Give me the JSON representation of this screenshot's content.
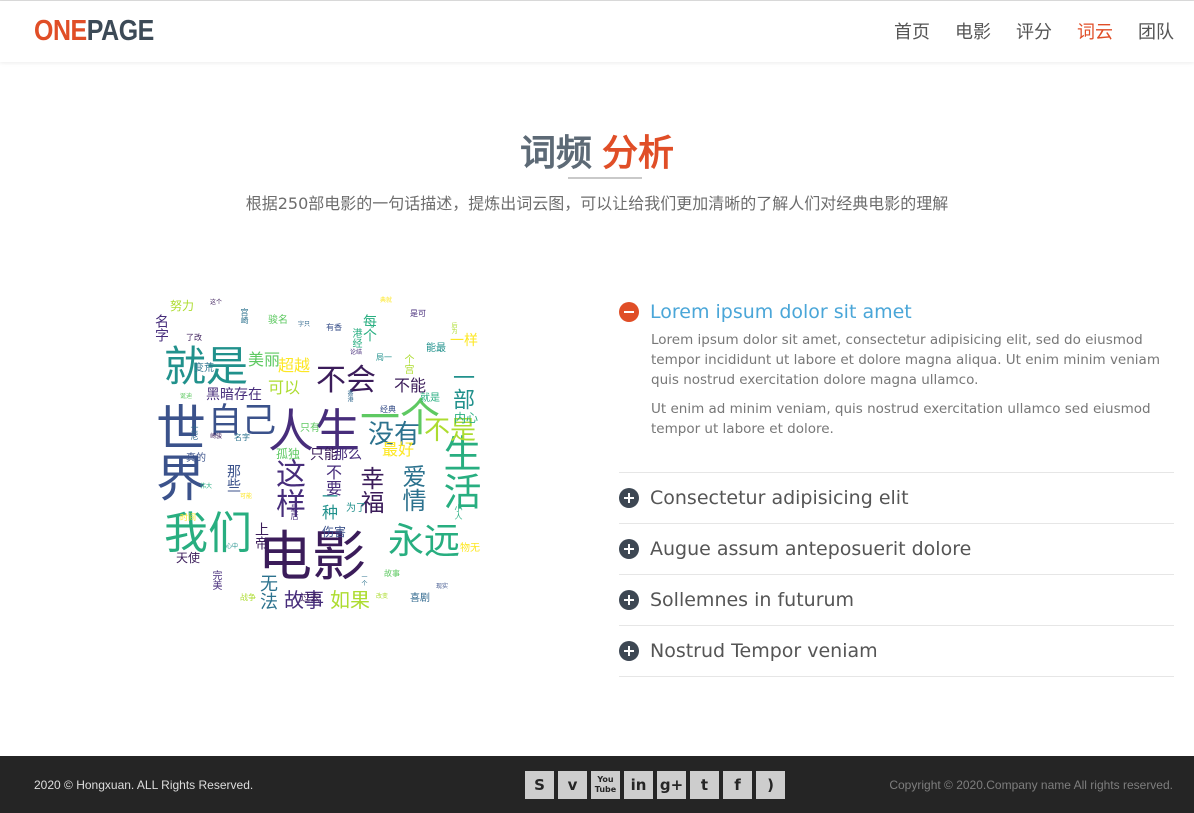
{
  "brand": {
    "part1": "ONE",
    "part2": "PAGE"
  },
  "nav": [
    {
      "label": "首页",
      "active": false
    },
    {
      "label": "电影",
      "active": false
    },
    {
      "label": "评分",
      "active": false
    },
    {
      "label": "词云",
      "active": true
    },
    {
      "label": "团队",
      "active": false
    }
  ],
  "section": {
    "title_main": "词频",
    "title_accent": "分析",
    "subtitle": "根据250部电影的一句话描述，提炼出词云图，可以让给我们更加清晰的了解人们对经典电影的理解"
  },
  "wordcloud": {
    "words": [
      "电影",
      "世界",
      "人生",
      "就是",
      "我们",
      "一个",
      "自己",
      "永远",
      "生活",
      "不会",
      "这样",
      "没有",
      "不是",
      "幸福",
      "爱情",
      "如果",
      "故事",
      "一部",
      "美丽",
      "超越",
      "可以",
      "不能",
      "黑暗",
      "存在",
      "最好",
      "只能",
      "那么",
      "一种",
      "不要",
      "无法",
      "一样",
      "名字",
      "天使",
      "伤害",
      "孤独",
      "上帝",
      "每个",
      "那些",
      "内心",
      "努力"
    ]
  },
  "accordion": [
    {
      "title": "Lorem ipsum dolor sit amet",
      "open": true,
      "paragraphs": [
        "Lorem ipsum dolor sit amet, consectetur adipisicing elit, sed do eiusmod tempor incididunt ut labore et dolore magna aliqua. Ut enim minim veniam quis nostrud exercitation dolore magna ullamco.",
        "Ut enim ad minim veniam, quis nostrud exercitation ullamco sed eiusmod tempor ut labore et dolore."
      ]
    },
    {
      "title": "Consectetur adipisicing elit",
      "open": false
    },
    {
      "title": "Augue assum anteposuerit dolore",
      "open": false
    },
    {
      "title": "Sollemnes in futurum",
      "open": false
    },
    {
      "title": "Nostrud Tempor veniam",
      "open": false
    }
  ],
  "footer": {
    "left": "2020 © Hongxuan. ALL Rights Reserved.",
    "right": "Copyright © 2020.Company name All rights reserved.",
    "social": [
      {
        "icon": "skype-icon",
        "glyph": "S"
      },
      {
        "icon": "vimeo-icon",
        "glyph": "v"
      },
      {
        "icon": "youtube-icon",
        "glyph": "You Tube"
      },
      {
        "icon": "linkedin-icon",
        "glyph": "in"
      },
      {
        "icon": "googleplus-icon",
        "glyph": "g+"
      },
      {
        "icon": "twitter-icon",
        "glyph": "t"
      },
      {
        "icon": "facebook-icon",
        "glyph": "f"
      },
      {
        "icon": "rss-icon",
        "glyph": ")"
      }
    ]
  },
  "colors": {
    "accent": "#e04e27",
    "dark": "#3c4a57",
    "link": "#4aa6d8",
    "footer_bg": "#252525"
  }
}
